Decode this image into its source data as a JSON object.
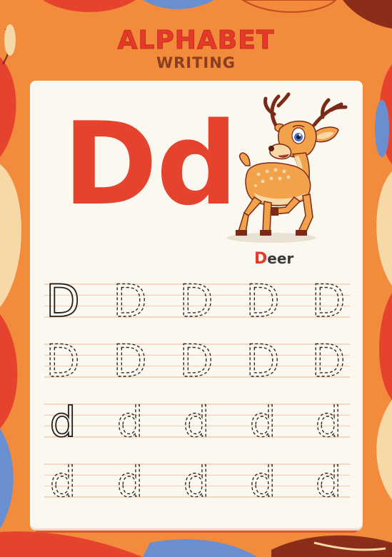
{
  "title": {
    "line1": "ALPHABET",
    "line2": "WRITING"
  },
  "letter": {
    "upper": "D",
    "lower": "d"
  },
  "word": {
    "first_letter": "D",
    "rest": "eer"
  },
  "illustration": {
    "name": "deer"
  },
  "tracing": {
    "rows": [
      {
        "glyph": "D",
        "solid_first": true,
        "count": 5
      },
      {
        "glyph": "D",
        "solid_first": false,
        "count": 5
      },
      {
        "glyph": "d",
        "solid_first": true,
        "count": 5
      },
      {
        "glyph": "d",
        "solid_first": false,
        "count": 5
      }
    ]
  },
  "colors": {
    "background": "#f28b3c",
    "accent_red": "#e5392a",
    "title_brown": "#8a3e22",
    "card": "#fbf8ef"
  }
}
